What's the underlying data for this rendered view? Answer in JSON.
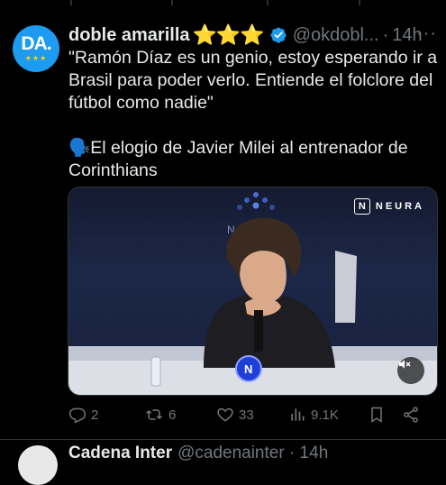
{
  "tweet": {
    "author_name": "doble amarilla",
    "name_badges": "⭐⭐⭐",
    "handle": "@okdobl...",
    "separator": "·",
    "time": "14h",
    "more": "···",
    "avatar_text": "DA.",
    "avatar_stars": "★★★",
    "text_line1": "\"Ramón Díaz es un genio, estoy esperando ir a Brasil para poder verlo. Entiende el folclore del fútbol como nadie\"",
    "text_line2": "🗣️El elogio de Javier Milei al entrenador de Corinthians",
    "media": {
      "brand": "NEURA",
      "brand_mark": "N",
      "backdrop_text": "NEU",
      "mic_logo": "N"
    },
    "actions": {
      "replies": "2",
      "retweets": "6",
      "likes": "33",
      "views": "9.1K"
    }
  },
  "next_tweet": {
    "author_name": "Cadena Inter",
    "handle": "@cadenainter · 14h"
  },
  "colors": {
    "background": "#000000",
    "text": "#e7e9ea",
    "muted": "#71767b",
    "accent": "#1d9bf0",
    "gold": "#ffd400"
  }
}
